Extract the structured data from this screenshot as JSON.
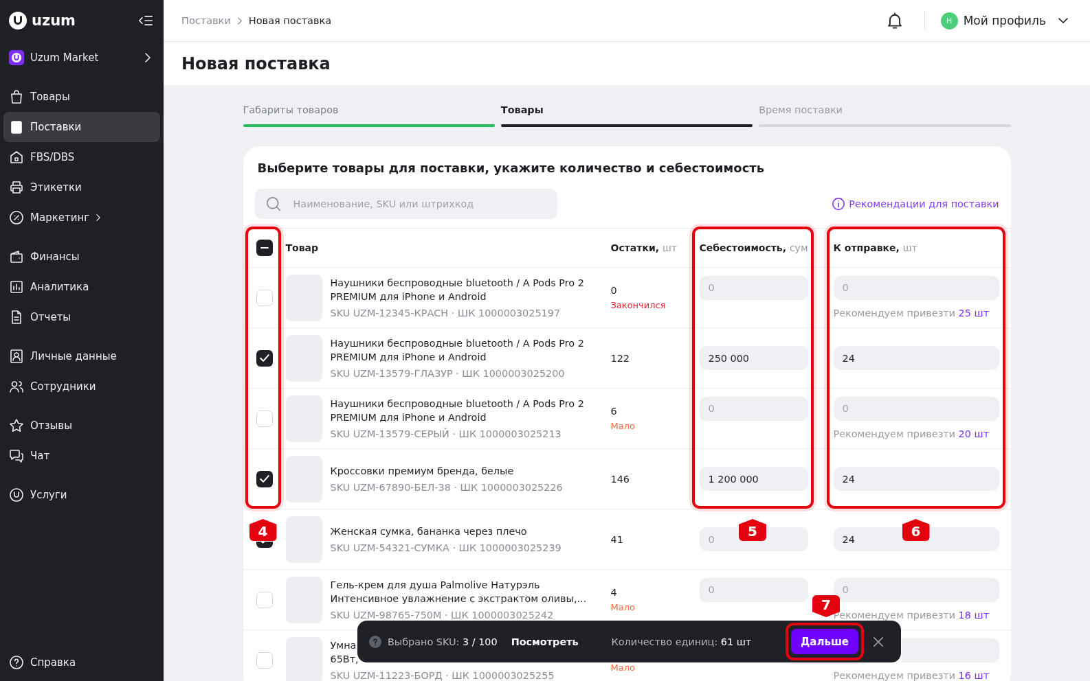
{
  "sidebar": {
    "logo": "uzum",
    "shop": {
      "name": "Uzum Market"
    },
    "sections": [
      {
        "items": [
          {
            "label": "Товары",
            "selected": false,
            "submenu": false
          },
          {
            "label": "Поставки",
            "selected": true,
            "submenu": false
          },
          {
            "label": "FBS/DBS",
            "selected": false,
            "submenu": false
          },
          {
            "label": "Этикетки",
            "selected": false,
            "submenu": false
          },
          {
            "label": "Маркетинг",
            "selected": false,
            "submenu": true
          }
        ]
      },
      {
        "items": [
          {
            "label": "Финансы",
            "selected": false,
            "submenu": false
          },
          {
            "label": "Аналитика",
            "selected": false,
            "submenu": false
          },
          {
            "label": "Отчеты",
            "selected": false,
            "submenu": false
          }
        ]
      },
      {
        "items": [
          {
            "label": "Личные данные",
            "selected": false,
            "submenu": false
          },
          {
            "label": "Сотрудники",
            "selected": false,
            "submenu": false
          }
        ]
      },
      {
        "items": [
          {
            "label": "Отзывы",
            "selected": false,
            "submenu": false
          },
          {
            "label": "Чат",
            "selected": false,
            "submenu": false
          }
        ]
      },
      {
        "items": [
          {
            "label": "Услуги",
            "selected": false,
            "submenu": false
          }
        ]
      }
    ],
    "help": {
      "label": "Справка"
    }
  },
  "header": {
    "breadcrumbs": [
      {
        "label": "Поставки",
        "current": false
      },
      {
        "label": "Новая поставка",
        "current": true
      }
    ],
    "profile": {
      "initial": "Н",
      "name": "Мой профиль"
    }
  },
  "page_title": "Новая поставка",
  "steps": [
    {
      "label": "Габариты товаров",
      "completed": true,
      "selected": false
    },
    {
      "label": "Товары",
      "completed": false,
      "selected": true
    },
    {
      "label": "Время поставки",
      "completed": false,
      "selected": false
    }
  ],
  "card": {
    "title": "Выберите товары для поставки, укажите количество и себестоимость",
    "search": {
      "placeholder": "Наименование, SKU или штрихкод"
    },
    "recommendations_link": "Рекомендации для поставки",
    "table": {
      "select_all": {
        "indeterminate": true,
        "callout": "4"
      },
      "columns": [
        {
          "label": "Товар"
        },
        {
          "label": "Остатки,",
          "unit": "шт"
        },
        {
          "label": "Себестоимость,",
          "unit": "сум",
          "callout": "5"
        },
        {
          "label": "К отправке,",
          "unit": "шт",
          "callout": "6"
        }
      ],
      "rows": [
        {
          "selected": false,
          "name": "Наушники беспроводные bluetooth / A Pods Pro 2 PREMIUM для iPhone и Android",
          "sku": "SKU UZM-12345-КРАСН · ШК 1000003025197",
          "stock": "0",
          "stock_status": {
            "label": "Закончился",
            "kind": "out"
          },
          "cost": {
            "placeholder": "0"
          },
          "qty": {
            "placeholder": "0"
          },
          "recommendation": {
            "text": "Рекомендуем привезти",
            "amount": "25 шт"
          }
        },
        {
          "selected": true,
          "name": "Наушники беспроводные bluetooth / A Pods Pro 2 PREMIUM для iPhone и Android",
          "sku": "SKU UZM-13579-ГЛАЗУР · ШК 1000003025200",
          "stock": "122",
          "cost": {
            "value": "250 000"
          },
          "qty": {
            "value": "24"
          }
        },
        {
          "selected": false,
          "name": "Наушники беспроводные bluetooth / A Pods Pro 2 PREMIUM для iPhone и Android",
          "sku": "SKU UZM-13579-СЕРЫЙ · ШК 1000003025213",
          "stock": "6",
          "stock_status": {
            "label": "Мало",
            "kind": "low"
          },
          "cost": {
            "placeholder": "0"
          },
          "qty": {
            "placeholder": "0"
          },
          "recommendation": {
            "text": "Рекомендуем привезти",
            "amount": "20 шт"
          }
        },
        {
          "selected": true,
          "name": "Кроссовки премиум бренда, белые",
          "sku": "SKU UZM-67890-БЕЛ-38 · ШК 1000003025226",
          "stock": "146",
          "cost": {
            "value": "1 200 000"
          },
          "qty": {
            "value": "24"
          }
        },
        {
          "selected": true,
          "name": "Женская сумка, бананка через плечо",
          "sku": "SKU UZM-54321-СУМКА · ШК 1000003025239",
          "stock": "41",
          "cost": {
            "placeholder": "0"
          },
          "qty": {
            "value": "24"
          }
        },
        {
          "selected": false,
          "name": "Гель-крем для душа Palmolive Натурэль Интенсивное увлажнение с экстрактом оливы,...",
          "sku": "SKU UZM-98765-750М · ШК 1000003025242",
          "stock": "4",
          "stock_status": {
            "label": "Мало",
            "kind": "low"
          },
          "cost": {
            "placeholder": "0"
          },
          "qty": {
            "placeholder": "0"
          },
          "recommendation": {
            "text": "Рекомендуем привезти",
            "amount": "18 шт"
          }
        },
        {
          "selected": false,
          "name": "Умна\n65Вт,",
          "sku": "SKU UZM-11223-БОРД · ШК 1000003025255",
          "stock_status": {
            "label": "Мало",
            "kind": "low"
          },
          "qty": {},
          "recommendation": {
            "text": "Рекомендуем привезти",
            "amount": "16 шт"
          }
        }
      ]
    }
  },
  "bottom_bar": {
    "selected_label": "Выбрано SKU:",
    "selected_value": "3 / 100",
    "view_link": "Посмотреть",
    "units_label": "Количество единиц:",
    "units_value": "61 шт",
    "next_button": {
      "label": "Дальше",
      "callout": "7"
    }
  }
}
